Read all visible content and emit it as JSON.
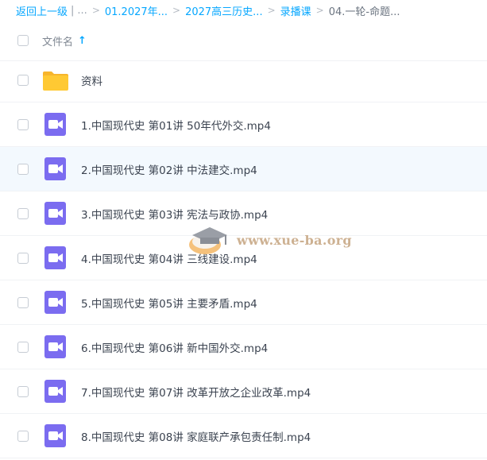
{
  "breadcrumb": {
    "back": "返回上一级",
    "divider": "|",
    "ellipsis": "...",
    "sep": ">",
    "crumbs": [
      "01.2027年...",
      "2027高三历史...",
      "录播课"
    ],
    "current": "04.一轮-命题..."
  },
  "header": {
    "name_label": "文件名",
    "sort_icon": "arrow-up-icon"
  },
  "files": [
    {
      "name": "资料",
      "type": "folder",
      "icon": "folder-icon"
    },
    {
      "name": "1.中国现代史 第01讲 50年代外交.mp4",
      "type": "video",
      "icon": "video-file-icon"
    },
    {
      "name": "2.中国现代史 第02讲 中法建交.mp4",
      "type": "video",
      "icon": "video-file-icon"
    },
    {
      "name": "3.中国现代史 第03讲 宪法与政协.mp4",
      "type": "video",
      "icon": "video-file-icon"
    },
    {
      "name": "4.中国现代史 第04讲 三线建设.mp4",
      "type": "video",
      "icon": "video-file-icon"
    },
    {
      "name": "5.中国现代史 第05讲 主要矛盾.mp4",
      "type": "video",
      "icon": "video-file-icon"
    },
    {
      "name": "6.中国现代史 第06讲 新中国外交.mp4",
      "type": "video",
      "icon": "video-file-icon"
    },
    {
      "name": "7.中国现代史 第07讲 改革开放之企业改革.mp4",
      "type": "video",
      "icon": "video-file-icon"
    },
    {
      "name": "8.中国现代史 第08讲 家庭联产承包责任制.mp4",
      "type": "video",
      "icon": "video-file-icon"
    }
  ],
  "watermark": {
    "text": "www.xue-ba.org"
  },
  "colors": {
    "accent": "#06a7ff",
    "folder": "#ffc933",
    "video": "#7b6cf0",
    "hover_row": "#f3f9fe"
  }
}
